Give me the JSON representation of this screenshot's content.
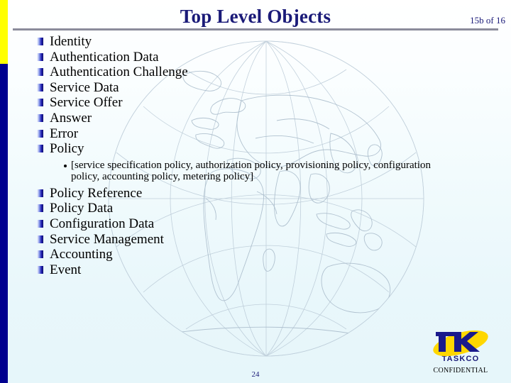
{
  "slide": {
    "title": "Top Level Objects",
    "page_indicator": "15b of 16",
    "slide_number": "24",
    "confidential_label": "CONFIDENTIAL"
  },
  "logo": {
    "mark_text": "TK",
    "company": "TASKCO",
    "swoosh_color": "#ffd700",
    "mark_color": "#1a1a8c"
  },
  "colors": {
    "title": "#1a1a78",
    "rule": "#8b8b9b",
    "stripe_top": "#ffff00",
    "stripe_bottom": "#00008f",
    "bullet_gradient_end": "#10106a",
    "background": "#e9f7fb"
  },
  "content": {
    "bullets_top": [
      {
        "label": "Identity"
      },
      {
        "label": "Authentication Data"
      },
      {
        "label": "Authentication Challenge"
      },
      {
        "label": "Service Data"
      },
      {
        "label": "Service Offer"
      },
      {
        "label": "Answer"
      },
      {
        "label": "Error"
      },
      {
        "label": "Policy"
      }
    ],
    "subbullet": "[service specification policy, authorization policy, provisioning policy, configuration policy, accounting policy, metering policy]",
    "bullets_bottom": [
      {
        "label": "Policy Reference"
      },
      {
        "label": "Policy Data"
      },
      {
        "label": "Configuration Data"
      },
      {
        "label": "Service Management"
      },
      {
        "label": "Accounting"
      },
      {
        "label": "Event"
      }
    ]
  }
}
